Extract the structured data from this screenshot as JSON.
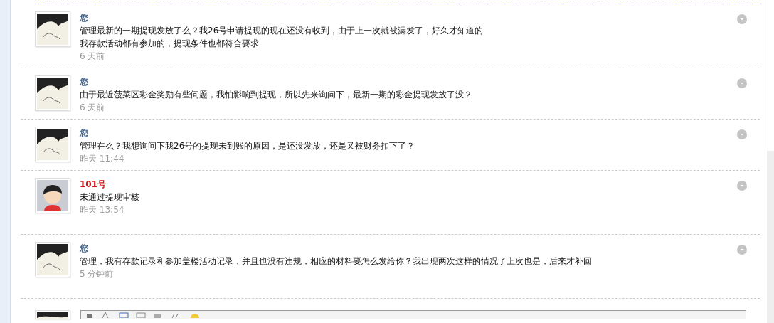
{
  "messages": [
    {
      "kind": "self",
      "name": "您",
      "lines": [
        "管理最新的一期提现发放了么？我26号申请提现的现在还没有收到，由于上一次就被漏发了，好久才知道的",
        "我存款活动都有参加的，提现条件也都符合要求"
      ],
      "time": "6 天前"
    },
    {
      "kind": "self",
      "name": "您",
      "lines": [
        "由于最近菠菜区彩金奖励有些问题，我怕影响到提现，所以先来询问下，最新一期的彩金提现发放了没？"
      ],
      "time": "6 天前"
    },
    {
      "kind": "self",
      "name": "您",
      "lines": [
        "管理在么？我想询问下我26号的提现未到账的原因，是还没发放，还是又被财务扣下了？"
      ],
      "time": "昨天 11:44"
    },
    {
      "kind": "staff",
      "name": "101号",
      "lines": [
        "未通过提现审核"
      ],
      "time": "昨天 13:54"
    },
    {
      "kind": "self",
      "name": "您",
      "lines": [
        "管理，我有存款记录和参加盖楼活动记录，并且也没有违规，相应的材料要怎么发给你？我出现两次这样的情况了上次也是，后来才补回"
      ],
      "time": "5 分钟前"
    }
  ]
}
